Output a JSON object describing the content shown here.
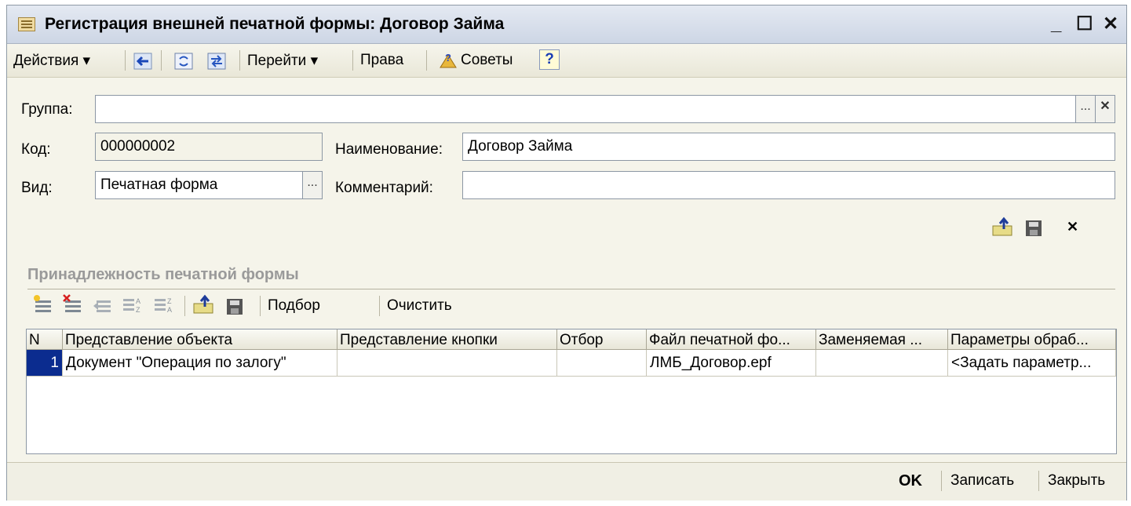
{
  "window": {
    "title": "Регистрация внешней печатной формы: Договор Займа",
    "minimize": "_",
    "maximize": "☐",
    "close": "✕"
  },
  "toolbar": {
    "actions": "Действия ▾",
    "goto": "Перейти ▾",
    "rights": "Права",
    "tips": "Советы",
    "help": "?"
  },
  "form": {
    "group_label": "Группа:",
    "group_value": "",
    "group_select": "...",
    "group_clear": "✕",
    "code_label": "Код:",
    "code_value": "000000002",
    "name_label": "Наименование:",
    "name_value": "Договор Займа",
    "kind_label": "Вид:",
    "kind_value": "Печатная форма",
    "kind_select": "...",
    "comment_label": "Комментарий:",
    "comment_value": "",
    "file_delete": "✕"
  },
  "section": {
    "title": "Принадлежность печатной формы",
    "select_label": "Подбор",
    "clear_label": "Очистить"
  },
  "table": {
    "columns": [
      "N",
      "Представление объекта",
      "Представление кнопки",
      "Отбор",
      "Файл печатной фо...",
      "Заменяемая ...",
      "Параметры обраб..."
    ],
    "rows": [
      [
        "1",
        "Документ \"Операция по залогу\"",
        "",
        "",
        "ЛМБ_Договор.epf",
        "",
        "<Задать параметр..."
      ]
    ]
  },
  "footer": {
    "ok": "OK",
    "save": "Записать",
    "close": "Закрыть"
  }
}
